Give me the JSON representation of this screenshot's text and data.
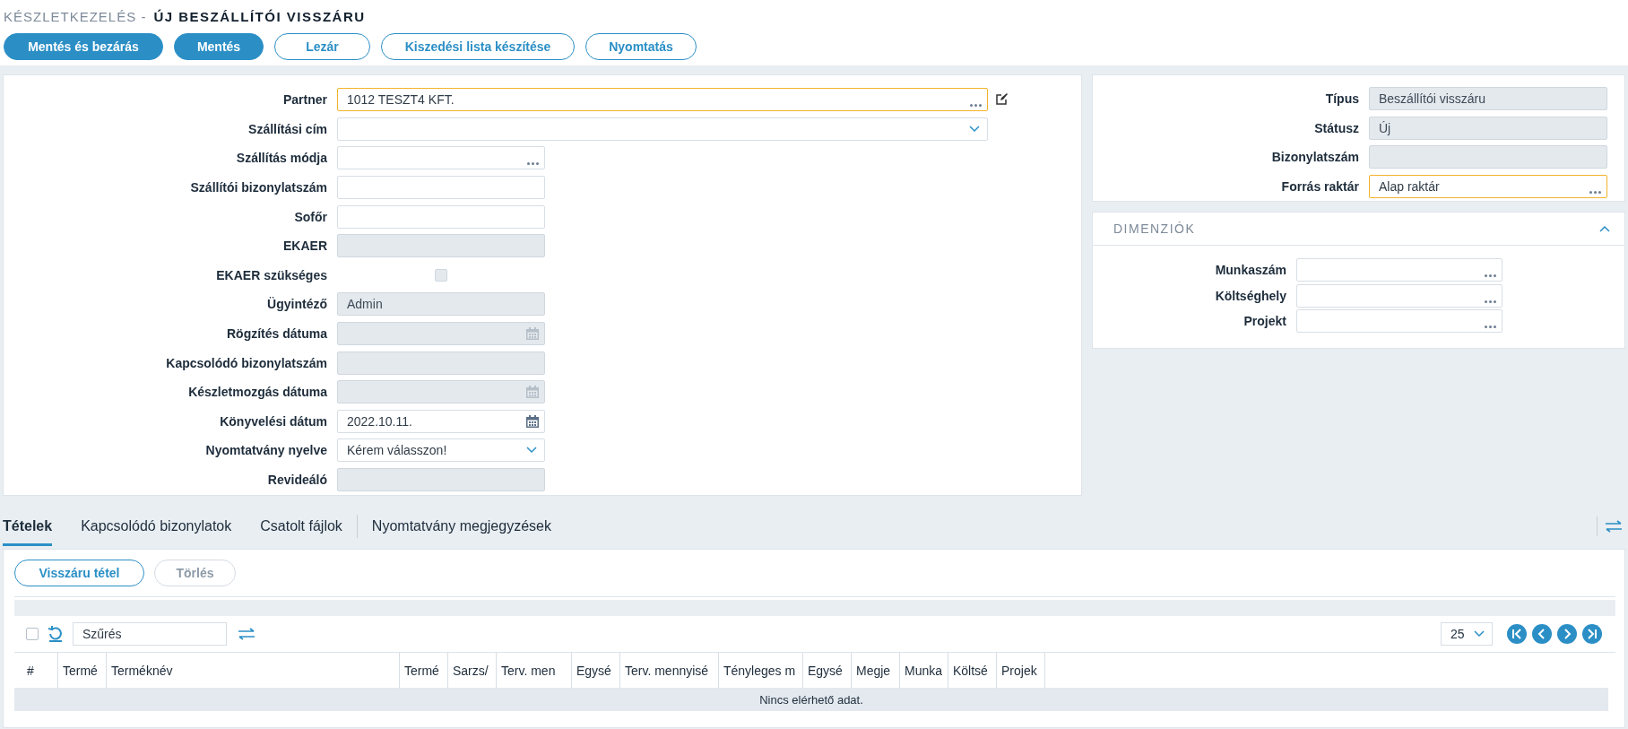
{
  "breadcrumb": {
    "section": "KÉSZLETKEZELÉS -",
    "title": "ÚJ BESZÁLLÍTÓI VISSZÁRU"
  },
  "actions": [
    {
      "label": "Mentés és bezárás",
      "kind": "primary"
    },
    {
      "label": "Mentés",
      "kind": "primary"
    },
    {
      "label": "Lezár",
      "kind": "outline"
    },
    {
      "label": "Kiszedési lista készítése",
      "kind": "outline"
    },
    {
      "label": "Nyomtatás",
      "kind": "outline"
    }
  ],
  "main_form": [
    {
      "label": "Partner",
      "kind": "lookup",
      "value": "1012 TESZT4 KFT.",
      "disabled": false,
      "highlighted": true,
      "editable": true
    },
    {
      "label": "Szállítási cím",
      "kind": "select",
      "disabled": false,
      "highlighted": false
    },
    {
      "label": "Szállítás módja",
      "kind": "lookup",
      "disabled": false,
      "highlighted": false
    },
    {
      "label": "Szállítói bizonylatszám",
      "kind": "text",
      "disabled": false,
      "highlighted": false
    },
    {
      "label": "Sofőr",
      "kind": "text",
      "disabled": false,
      "highlighted": false
    },
    {
      "label": "EKAER",
      "kind": "text",
      "disabled": true,
      "highlighted": false
    },
    {
      "label": "EKAER szükséges",
      "kind": "checkbox",
      "checked": false,
      "disabled": true
    },
    {
      "label": "Ügyintéző",
      "kind": "text",
      "value": "Admin",
      "disabled": true,
      "highlighted": false
    },
    {
      "label": "Rögzítés dátuma",
      "kind": "date",
      "disabled": true,
      "highlighted": false
    },
    {
      "label": "Kapcsolódó bizonylatszám",
      "kind": "text",
      "disabled": true,
      "highlighted": false
    },
    {
      "label": "Készletmozgás dátuma",
      "kind": "date",
      "disabled": true,
      "highlighted": false
    },
    {
      "label": "Könyvelési dátum",
      "kind": "date",
      "value": "2022.10.11.",
      "disabled": false,
      "highlighted": false
    },
    {
      "label": "Nyomtatvány nyelve",
      "kind": "select",
      "value": "Kérem válasszon!",
      "disabled": false,
      "highlighted": false
    },
    {
      "label": "Revideáló",
      "kind": "text",
      "disabled": true,
      "highlighted": false
    }
  ],
  "side_form": [
    {
      "label": "Típus",
      "kind": "text",
      "value": "Beszállítói visszáru",
      "disabled": true,
      "highlighted": false
    },
    {
      "label": "Státusz",
      "kind": "text",
      "value": "Új",
      "disabled": true,
      "highlighted": false
    },
    {
      "label": "Bizonylatszám",
      "kind": "text",
      "disabled": true,
      "highlighted": false
    },
    {
      "label": "Forrás raktár",
      "kind": "lookup",
      "value": "Alap raktár",
      "disabled": false,
      "highlighted": true
    }
  ],
  "dimensions": {
    "title": "DIMENZIÓK",
    "expanded": true,
    "fields": [
      {
        "label": "Munkaszám",
        "kind": "lookup"
      },
      {
        "label": "Költséghely",
        "kind": "lookup"
      },
      {
        "label": "Projekt",
        "kind": "lookup"
      }
    ]
  },
  "tabs": [
    {
      "label": "Tételek",
      "selected": true
    },
    {
      "label": "Kapcsolódó bizonylatok",
      "selected": false
    },
    {
      "label": "Csatolt fájlok",
      "selected": false
    },
    {
      "label": "Nyomtatvány megjegyzések",
      "selected": false
    }
  ],
  "item_actions": [
    {
      "label": "Visszáru tétel",
      "disabled": false
    },
    {
      "label": "Törlés",
      "disabled": true
    }
  ],
  "grid": {
    "select_all": false,
    "filter_placeholder": "Szűrés",
    "page_size": "25",
    "columns": [
      "#",
      "Termé",
      "Terméknév",
      "Termé",
      "Sarzs/",
      "Terv. men",
      "Egysé",
      "Terv. mennyisé",
      "Tényleges m",
      "Egysé",
      "Megje",
      "Munka",
      "Költsé",
      "Projek"
    ],
    "empty_text": "Nincs elérhető adat."
  }
}
